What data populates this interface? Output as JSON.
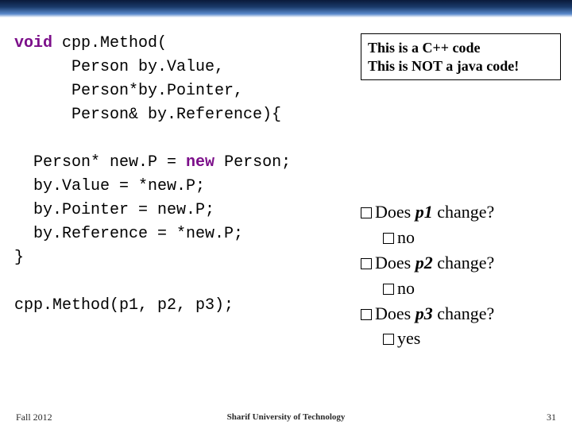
{
  "code": {
    "lines": [
      "void cpp.Method(",
      "      Person by.Value,",
      "      Person*by.Pointer,",
      "      Person& by.Reference){",
      "",
      "  Person* new.P = new Person;",
      "  by.Value = *new.P;",
      "  by.Pointer = new.P;",
      "  by.Reference = *new.P;",
      "}",
      "",
      "cpp.Method(p1, p2, p3);"
    ],
    "kw_void": "void",
    "kw_new": "new",
    "sig_part1": " cpp.Method(",
    "sig_line2": "      Person by.Value,",
    "sig_line3": "      Person*by.Pointer,",
    "sig_line4": "      Person& by.Reference){",
    "body_pre": "  Person* new.P = ",
    "body_post": " Person;",
    "body2": "  by.Value = *new.P;",
    "body3": "  by.Pointer = new.P;",
    "body4": "  by.Reference = *new.P;",
    "close": "}",
    "call": "cpp.Method(p1, p2, p3);"
  },
  "note": {
    "line1": "This is a C++ code",
    "line2": "This is NOT a java code!"
  },
  "qa": {
    "q1_pre": "Does ",
    "q1_var": "p1",
    "q1_post": " change?",
    "a1": "no",
    "q2_pre": "Does ",
    "q2_var": "p2",
    "q2_post": " change?",
    "a2": "no",
    "q3_pre": "Does ",
    "q3_var": "p3",
    "q3_post": " change?",
    "a3": "yes"
  },
  "footer": {
    "left": "Fall 2012",
    "center": "Sharif University of Technology",
    "right": "31"
  }
}
